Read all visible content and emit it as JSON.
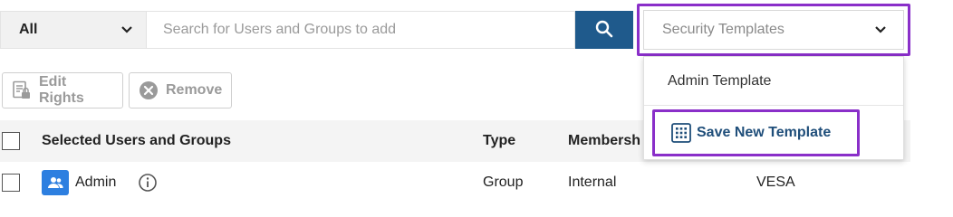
{
  "scope_select": {
    "value": "All",
    "icon": "chevron-down-icon"
  },
  "search": {
    "placeholder": "Search for Users and Groups to add",
    "button_icon": "search-icon"
  },
  "templates_select": {
    "placeholder": "Security Templates",
    "icon": "chevron-down-icon"
  },
  "toolbar": {
    "edit_rights_label": "Edit Rights",
    "remove_label": "Remove"
  },
  "table": {
    "columns": [
      "Selected Users and Groups",
      "Type",
      "Membersh"
    ],
    "rows": [
      {
        "name": "Admin",
        "type": "Group",
        "membership": "Internal",
        "source": "VESA"
      }
    ]
  },
  "templates_menu": {
    "items": [
      {
        "label": "Admin Template"
      },
      {
        "label": "Save New Template"
      }
    ]
  },
  "colors": {
    "accent": "#1f5a8c",
    "highlight": "#8a2fc9",
    "group_icon": "#2d7fe0"
  }
}
